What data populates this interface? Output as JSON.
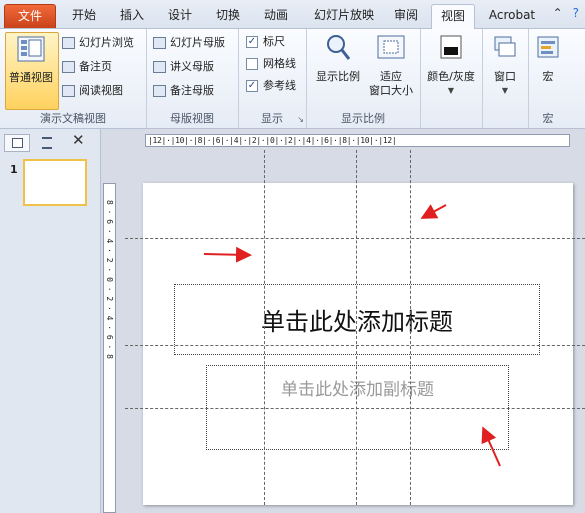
{
  "tabs": {
    "file": "文件",
    "home": "开始",
    "insert": "插入",
    "design": "设计",
    "transitions": "切换",
    "animations": "动画",
    "slideshow": "幻灯片放映",
    "review": "审阅",
    "view": "视图",
    "acrobat": "Acrobat"
  },
  "ribbon": {
    "presentation_views": {
      "normal": "普通视图",
      "slide_sorter": "幻灯片浏览",
      "notes_page": "备注页",
      "reading_view": "阅读视图",
      "label": "演示文稿视图"
    },
    "master_views": {
      "slide_master": "幻灯片母版",
      "handout_master": "讲义母版",
      "notes_master": "备注母版",
      "label": "母版视图"
    },
    "show": {
      "ruler": "标尺",
      "gridlines": "网格线",
      "guides": "参考线",
      "label": "显示",
      "ruler_checked": "✓",
      "guides_checked": "✓"
    },
    "zoom": {
      "zoom": "显示比例",
      "fit_line1": "适应",
      "fit_line2": "窗口大小",
      "label": "显示比例"
    },
    "color": {
      "label": "颜色/灰度"
    },
    "window": {
      "label": "窗口"
    },
    "macros": {
      "label": "宏",
      "group_label": "宏"
    }
  },
  "panel": {
    "slide_number": "1"
  },
  "rulers": {
    "horizontal": "|12|·|10|·|8|·|6|·|4|·|2|·|0|·|2|·|4|·|6|·|8|·|10|·|12|",
    "vertical": "8 · 6 · 4 · 2 · 0 · 2 · 4 · 6 · 8"
  },
  "slide": {
    "title_placeholder": "单击此处添加标题",
    "subtitle_placeholder": "单击此处添加副标题"
  },
  "colors": {
    "file_tab": "#d4501f",
    "annotation_arrow": "#e02020",
    "selected_button": "#ffd25e"
  }
}
